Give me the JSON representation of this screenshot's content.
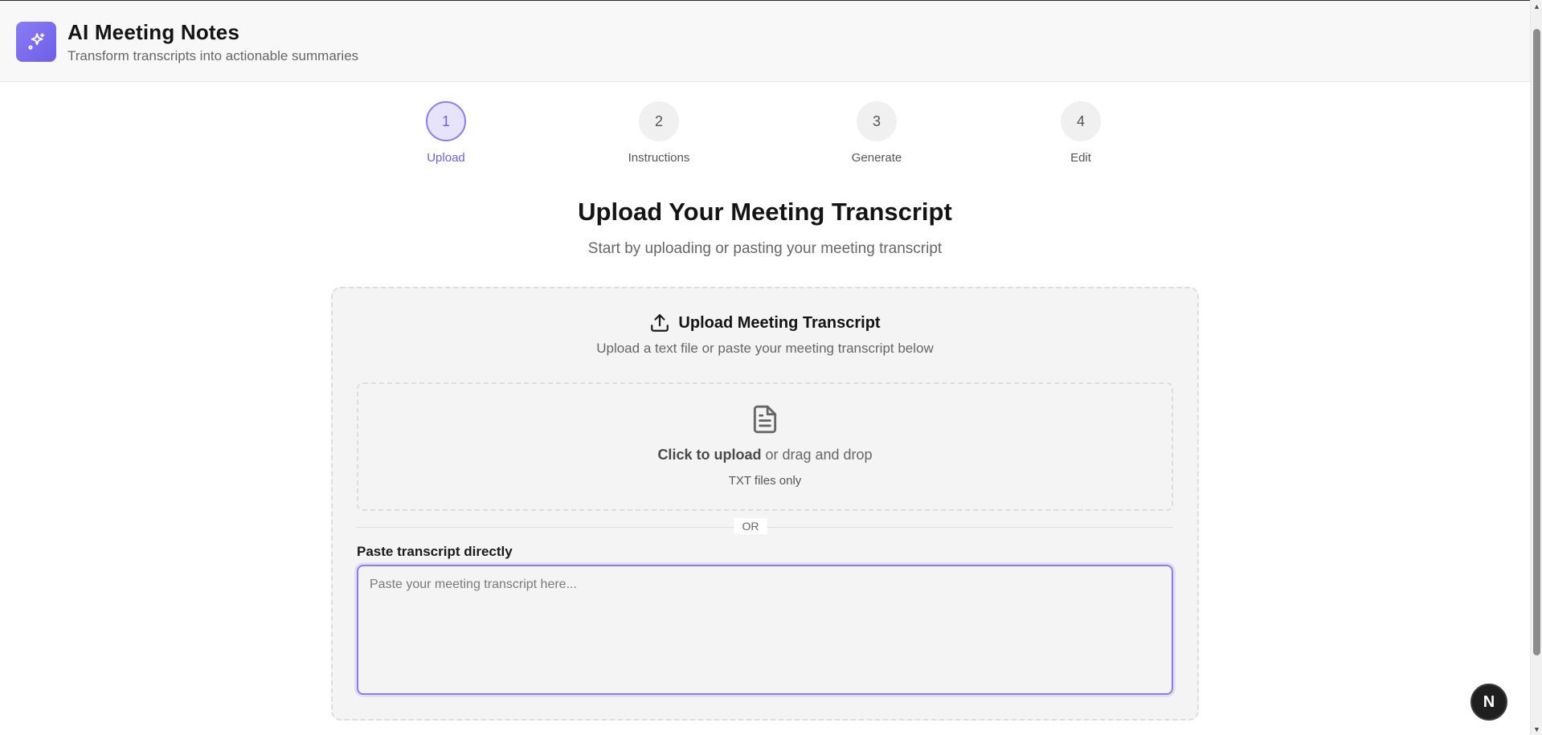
{
  "header": {
    "title": "AI Meeting Notes",
    "subtitle": "Transform transcripts into actionable summaries",
    "logo_icon": "sparkles-icon",
    "accent_color": "#7b6cf0"
  },
  "stepper": {
    "active_index": 0,
    "steps": [
      {
        "number": "1",
        "label": "Upload"
      },
      {
        "number": "2",
        "label": "Instructions"
      },
      {
        "number": "3",
        "label": "Generate"
      },
      {
        "number": "4",
        "label": "Edit"
      }
    ]
  },
  "main": {
    "title": "Upload Your Meeting Transcript",
    "subtitle": "Start by uploading or pasting your meeting transcript"
  },
  "upload_card": {
    "icon": "upload-icon",
    "title": "Upload Meeting Transcript",
    "description": "Upload a text file or paste your meeting transcript below",
    "dropzone": {
      "icon": "file-text-icon",
      "click_text": "Click to upload",
      "rest_text": " or drag and drop",
      "note": "TXT files only"
    },
    "divider": "OR",
    "paste_label": "Paste transcript directly",
    "paste_placeholder": "Paste your meeting transcript here...",
    "paste_value": ""
  },
  "fab": {
    "label": "N",
    "icon": "next-logo-icon"
  }
}
